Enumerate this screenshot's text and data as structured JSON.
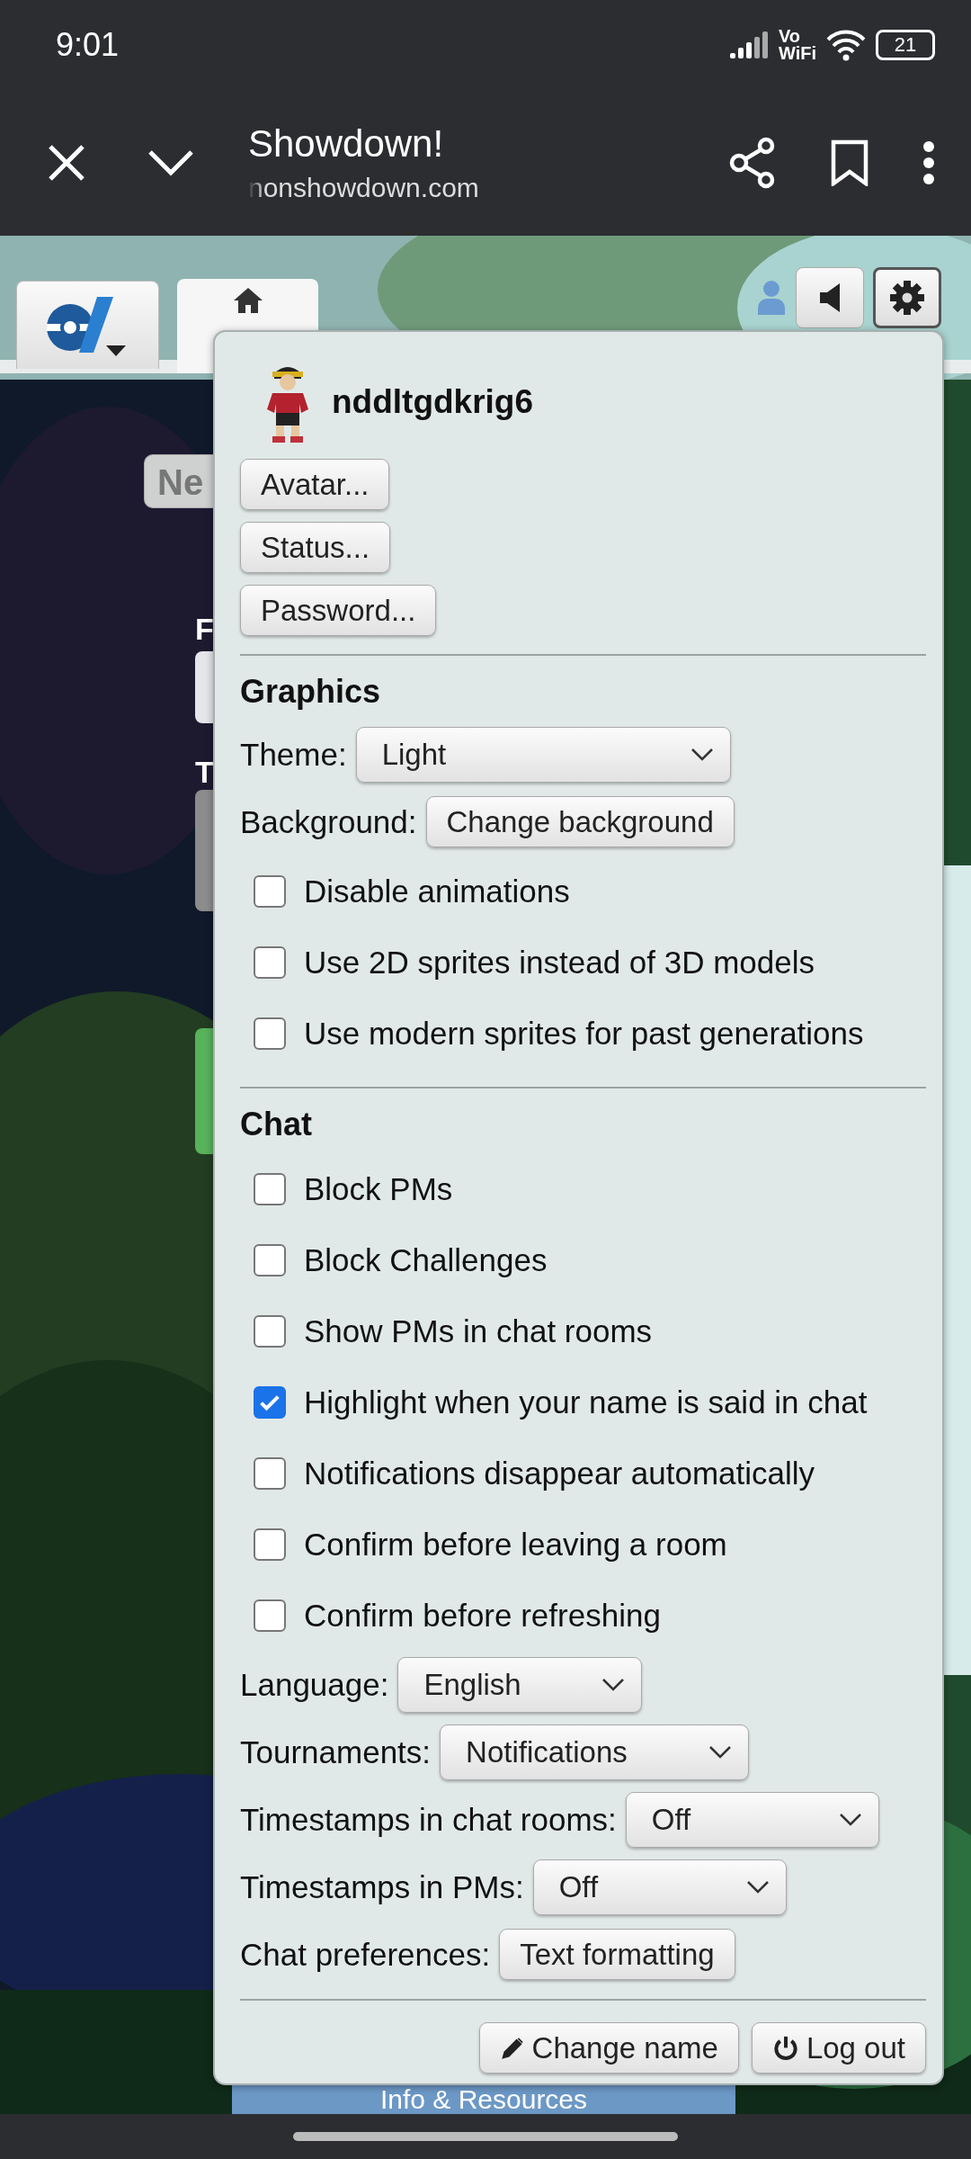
{
  "status_bar": {
    "time": "9:01",
    "network_top": "Vo",
    "network_bottom": "WiFi",
    "battery": "21"
  },
  "browser": {
    "title": "Showdown!",
    "url": "nonshowdown.com"
  },
  "background_page": {
    "new_button": "Ne",
    "labels": [
      "F",
      "T"
    ],
    "info_panel": "Info & Resources"
  },
  "settings": {
    "username": "nddltgdkrig6",
    "account_buttons": [
      "Avatar...",
      "Status...",
      "Password..."
    ],
    "sections": [
      {
        "heading": "Graphics",
        "items": [
          {
            "kind": "select",
            "label": "Theme:",
            "value": "Light"
          },
          {
            "kind": "button",
            "label": "Background:",
            "value": "Change background"
          },
          {
            "kind": "checkbox",
            "label": "Disable animations",
            "checked": false
          },
          {
            "kind": "checkbox",
            "label": "Use 2D sprites instead of 3D models",
            "checked": false
          },
          {
            "kind": "checkbox",
            "label": "Use modern sprites for past generations",
            "checked": false
          }
        ]
      },
      {
        "heading": "Chat",
        "items": [
          {
            "kind": "checkbox",
            "label": "Block PMs",
            "checked": false
          },
          {
            "kind": "checkbox",
            "label": "Block Challenges",
            "checked": false
          },
          {
            "kind": "checkbox",
            "label": "Show PMs in chat rooms",
            "checked": false
          },
          {
            "kind": "checkbox",
            "label": "Highlight when your name is said in chat",
            "checked": true
          },
          {
            "kind": "checkbox",
            "label": "Notifications disappear automatically",
            "checked": false
          },
          {
            "kind": "checkbox",
            "label": "Confirm before leaving a room",
            "checked": false
          },
          {
            "kind": "checkbox",
            "label": "Confirm before refreshing",
            "checked": false
          },
          {
            "kind": "select",
            "label": "Language:",
            "value": "English"
          },
          {
            "kind": "select",
            "label": "Tournaments:",
            "value": "Notifications"
          },
          {
            "kind": "select",
            "label": "Timestamps in chat rooms:",
            "value": "Off"
          },
          {
            "kind": "select",
            "label": "Timestamps in PMs:",
            "value": "Off"
          },
          {
            "kind": "button",
            "label": "Chat preferences:",
            "value": "Text formatting"
          }
        ]
      }
    ],
    "footer_buttons": [
      {
        "kind": "edit",
        "label": "Change name"
      },
      {
        "kind": "logout",
        "label": "Log out"
      }
    ]
  }
}
